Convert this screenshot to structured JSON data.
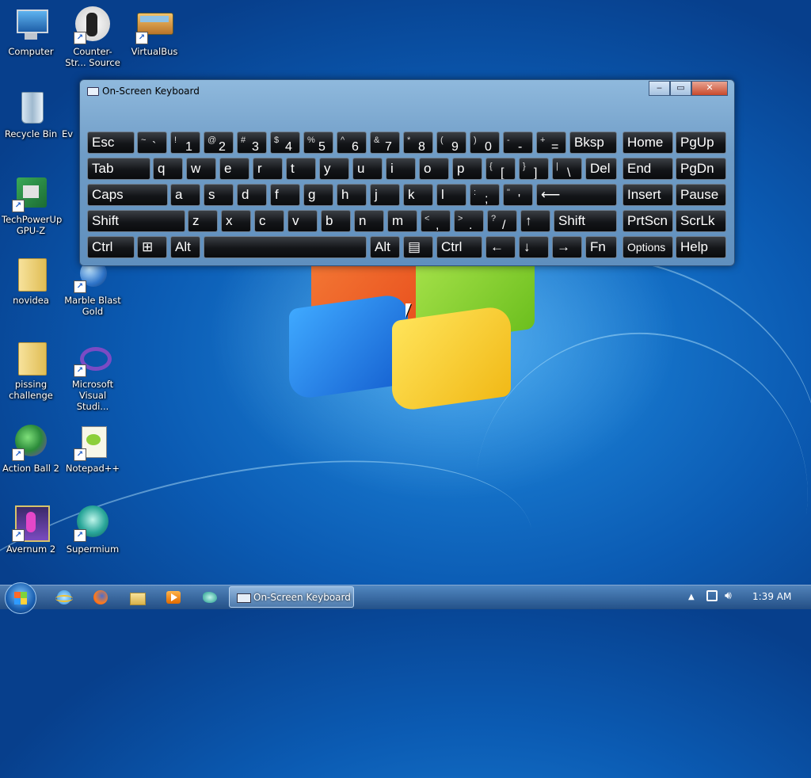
{
  "desktop_icons": [
    {
      "label": "Computer",
      "icon": "computer-icon"
    },
    {
      "label": "Counter-Str... Source",
      "icon": "counter-strike-icon"
    },
    {
      "label": "VirtualBus",
      "icon": "bus-icon"
    },
    {
      "label": "Recycle Bin",
      "icon": "recycle-bin-icon"
    },
    {
      "label": "Ev",
      "icon": "partial-icon"
    },
    {
      "label": "TechPowerUp GPU-Z",
      "icon": "gpu-z-icon"
    },
    {
      "label": "novidea",
      "icon": "folder-icon"
    },
    {
      "label": "Marble Blast Gold",
      "icon": "marble-blast-icon"
    },
    {
      "label": "pissing challenge",
      "icon": "folder-icon"
    },
    {
      "label": "Microsoft Visual Studi...",
      "icon": "visual-studio-icon"
    },
    {
      "label": "Action Ball 2",
      "icon": "action-ball-icon"
    },
    {
      "label": "Notepad++",
      "icon": "notepadpp-icon"
    },
    {
      "label": "Avernum 2",
      "icon": "avernum-icon"
    },
    {
      "label": "Supermium",
      "icon": "supermium-icon"
    }
  ],
  "osk": {
    "title": "On-Screen Keyboard",
    "controls": {
      "minimize": "‒",
      "maximize": "▭",
      "close": "✕"
    },
    "keys": {
      "esc": "Esc",
      "tilde_sub": "~",
      "tilde_main": "`",
      "k1_sub": "!",
      "k1": "1",
      "k2_sub": "@",
      "k2": "2",
      "k3_sub": "#",
      "k3": "3",
      "k4_sub": "$",
      "k4": "4",
      "k5_sub": "%",
      "k5": "5",
      "k6_sub": "^",
      "k6": "6",
      "k7_sub": "&",
      "k7": "7",
      "k8_sub": "*",
      "k8": "8",
      "k9_sub": "(",
      "k9": "9",
      "k0_sub": ")",
      "k0": "0",
      "minus_sub": "-",
      "minus": "-",
      "plus_sub": "+",
      "plus": "=",
      "bksp": "Bksp",
      "home": "Home",
      "pgup": "PgUp",
      "tab": "Tab",
      "q": "q",
      "w": "w",
      "e": "e",
      "r": "r",
      "t": "t",
      "y": "y",
      "u": "u",
      "i": "i",
      "o": "o",
      "p": "p",
      "lbr_sub": "{",
      "lbr": "[",
      "rbr_sub": "}",
      "rbr": "]",
      "bsl_sub": "|",
      "bsl": "\\",
      "del": "Del",
      "end": "End",
      "pgdn": "PgDn",
      "caps": "Caps",
      "a": "a",
      "s": "s",
      "d": "d",
      "f": "f",
      "g": "g",
      "h": "h",
      "j": "j",
      "k": "k",
      "l": "l",
      "semi_sub": ":",
      "semi": ";",
      "quote_sub": "\"",
      "quote": "'",
      "enter": "⟵",
      "insert": "Insert",
      "pause": "Pause",
      "shift_l": "Shift",
      "z": "z",
      "x": "x",
      "c": "c",
      "v": "v",
      "b": "b",
      "n": "n",
      "m": "m",
      "comma_sub": "<",
      "comma": ",",
      "period_sub": ">",
      "period": ".",
      "slash_sub": "?",
      "slash": "/",
      "up": "↑",
      "shift_r": "Shift",
      "prtscn": "PrtScn",
      "scrlk": "ScrLk",
      "ctrl_l": "Ctrl",
      "win": "⊞",
      "alt_l": "Alt",
      "alt_r": "Alt",
      "menu": "▤",
      "ctrl_r": "Ctrl",
      "left": "←",
      "down": "↓",
      "right": "→",
      "fn": "Fn",
      "options": "Options",
      "help": "Help"
    }
  },
  "taskbar": {
    "pinned": [
      "internet-explorer-icon",
      "firefox-icon",
      "explorer-folder-icon",
      "media-player-icon",
      "pinned-app-icon"
    ],
    "active_task": "On-Screen Keyboard",
    "clock": "1:39 AM"
  }
}
